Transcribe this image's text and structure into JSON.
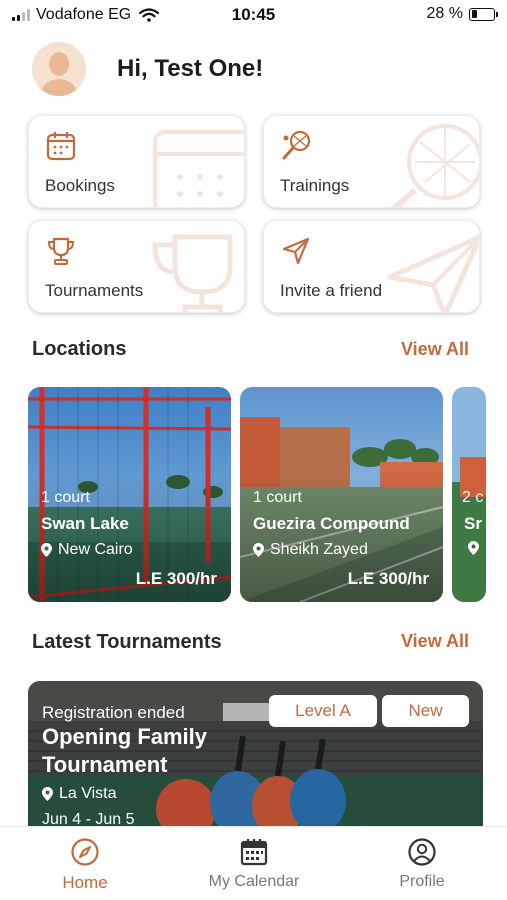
{
  "status_bar": {
    "carrier": "Vodafone EG",
    "time": "10:45",
    "battery": "28 %",
    "battery_level": 0.28
  },
  "header": {
    "greeting": "Hi, Test One!"
  },
  "quick_actions": [
    {
      "label": "Bookings",
      "icon": "calendar-icon"
    },
    {
      "label": "Trainings",
      "icon": "racket-icon"
    },
    {
      "label": "Tournaments",
      "icon": "trophy-icon"
    },
    {
      "label": "Invite a friend",
      "icon": "paper-plane-icon"
    }
  ],
  "locations": {
    "title": "Locations",
    "view_all": "View All",
    "items": [
      {
        "courts": "1 court",
        "name": "Swan Lake",
        "area": "New Cairo",
        "price": "L.E 300/hr"
      },
      {
        "courts": "1 court",
        "name": "Guezira Compound",
        "area": "Sheikh Zayed",
        "price": "L.E 300/hr"
      },
      {
        "courts": "2 c",
        "name": "Sr",
        "area": "",
        "price": ""
      }
    ]
  },
  "tournaments": {
    "title": "Latest Tournaments",
    "view_all": "View All",
    "items": [
      {
        "status": "Registration ended",
        "name": "Opening Family Tournament",
        "location": "La Vista",
        "dates": "Jun 4 - Jun 5",
        "level": "Level A",
        "tag": "New"
      }
    ]
  },
  "bottom_nav": [
    {
      "label": "Home",
      "icon": "compass-icon",
      "active": true
    },
    {
      "label": "My Calendar",
      "icon": "calendar-grid-icon",
      "active": false
    },
    {
      "label": "Profile",
      "icon": "user-circle-icon",
      "active": false
    }
  ],
  "colors": {
    "accent": "#c26a3b",
    "text": "#222222"
  }
}
